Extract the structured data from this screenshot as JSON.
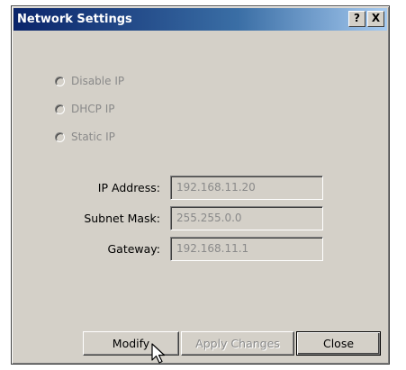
{
  "window": {
    "title": "Network Settings",
    "help_label": "?",
    "close_label": "X"
  },
  "radio_options": [
    {
      "label": "Disable IP",
      "selected": false,
      "enabled": false
    },
    {
      "label": "DHCP IP",
      "selected": false,
      "enabled": false
    },
    {
      "label": "Static IP",
      "selected": false,
      "enabled": false
    }
  ],
  "fields": {
    "ip_address": {
      "label": "IP Address:",
      "value": "192.168.11.20"
    },
    "subnet_mask": {
      "label": "Subnet Mask:",
      "value": "255.255.0.0"
    },
    "gateway": {
      "label": "Gateway:",
      "value": "192.168.11.1"
    }
  },
  "buttons": {
    "modify": "Modify",
    "apply": "Apply Changes",
    "close": "Close"
  },
  "colors": {
    "dialog_bg": "#d4d0c8",
    "title_start": "#0a246a",
    "title_end": "#a6caf0",
    "disabled_text": "#8a8a8a"
  }
}
